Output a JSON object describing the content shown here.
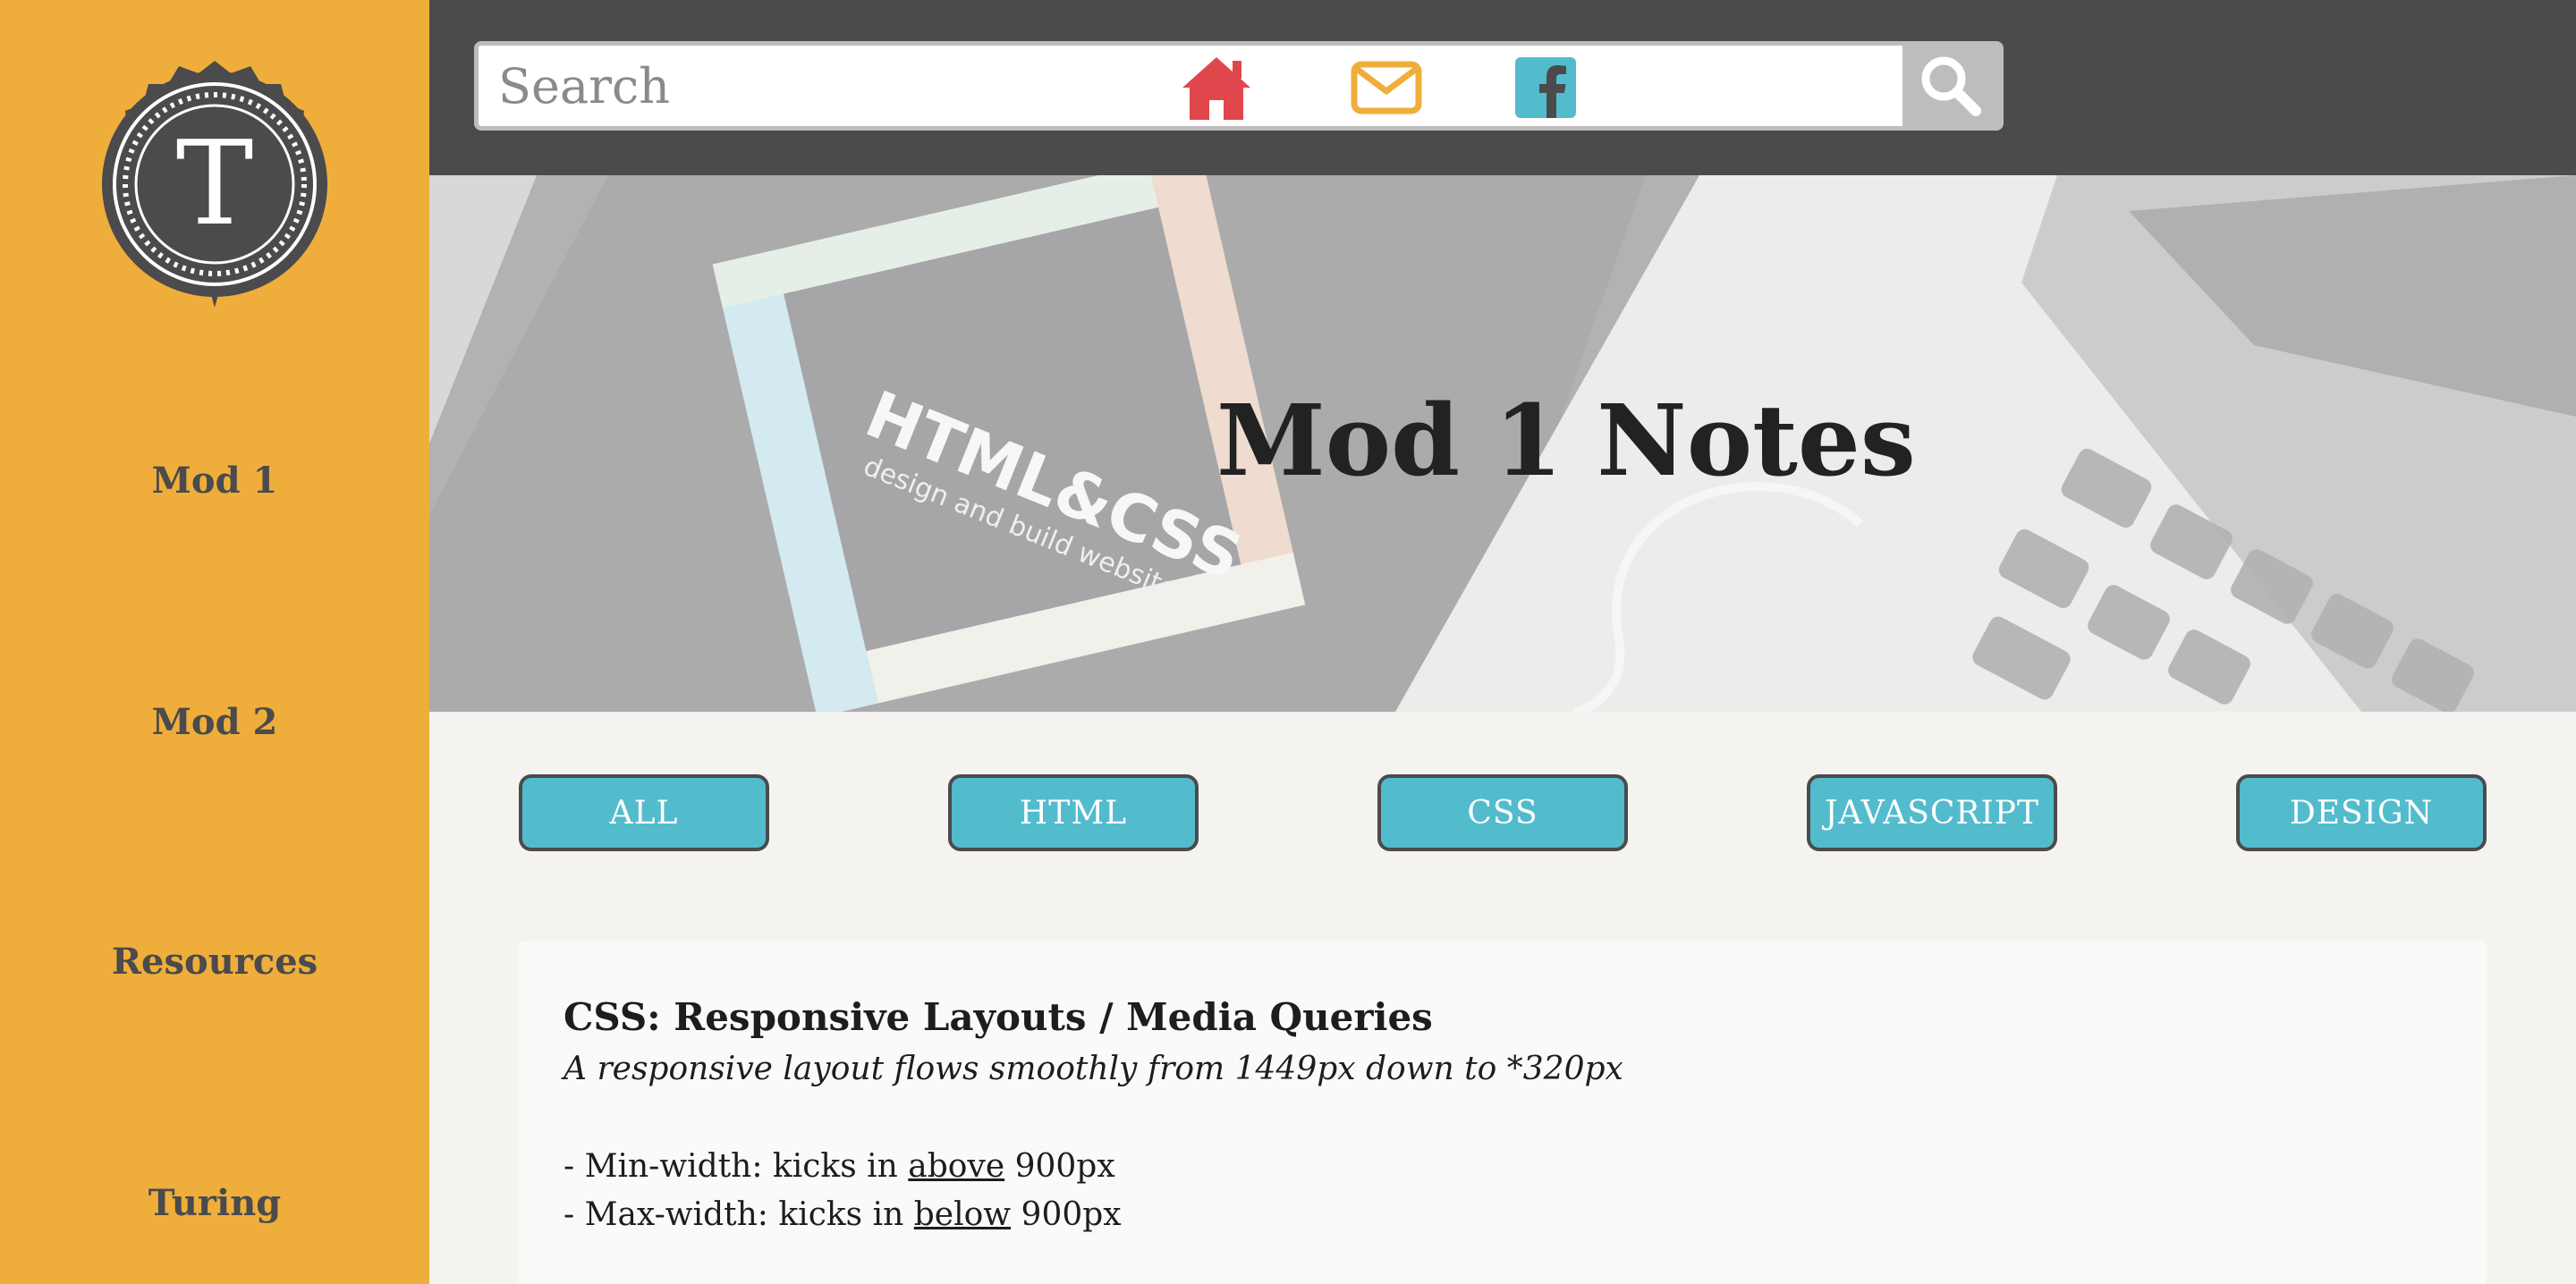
{
  "sidebar": {
    "logo_letter": "T",
    "items": [
      {
        "label": "Mod 1"
      },
      {
        "label": "Mod 2"
      },
      {
        "label": "Resources"
      },
      {
        "label": "Turing"
      }
    ]
  },
  "header": {
    "search": {
      "placeholder": "Search",
      "value": ""
    },
    "icons": [
      "search-icon",
      "home-icon",
      "mail-icon",
      "facebook-icon"
    ]
  },
  "hero": {
    "title": "Mod 1 Notes",
    "book_title": "HTML&CSS",
    "book_subtitle": "design and build websites"
  },
  "filters": [
    {
      "label": "ALL"
    },
    {
      "label": "HTML"
    },
    {
      "label": "CSS"
    },
    {
      "label": "JAVASCRIPT"
    },
    {
      "label": "DESIGN"
    }
  ],
  "note": {
    "title": "CSS: Responsive Layouts / Media Queries",
    "subtitle": "A responsive layout flows smoothly from 1449px down to *320px",
    "lines": [
      {
        "prefix": "- Min-width: kicks in ",
        "emphasis": "above",
        "suffix": " 900px"
      },
      {
        "prefix": "- Max-width: kicks in ",
        "emphasis": "below",
        "suffix": " 900px"
      }
    ]
  },
  "colors": {
    "sidebar": "#efae3b",
    "topbar": "#4b4a4c",
    "accent_teal": "#52bccd",
    "home_icon": "#e0474c",
    "mail_icon": "#efae3b",
    "facebook_icon": "#52bccd",
    "page_bg": "#f4f3ef"
  }
}
